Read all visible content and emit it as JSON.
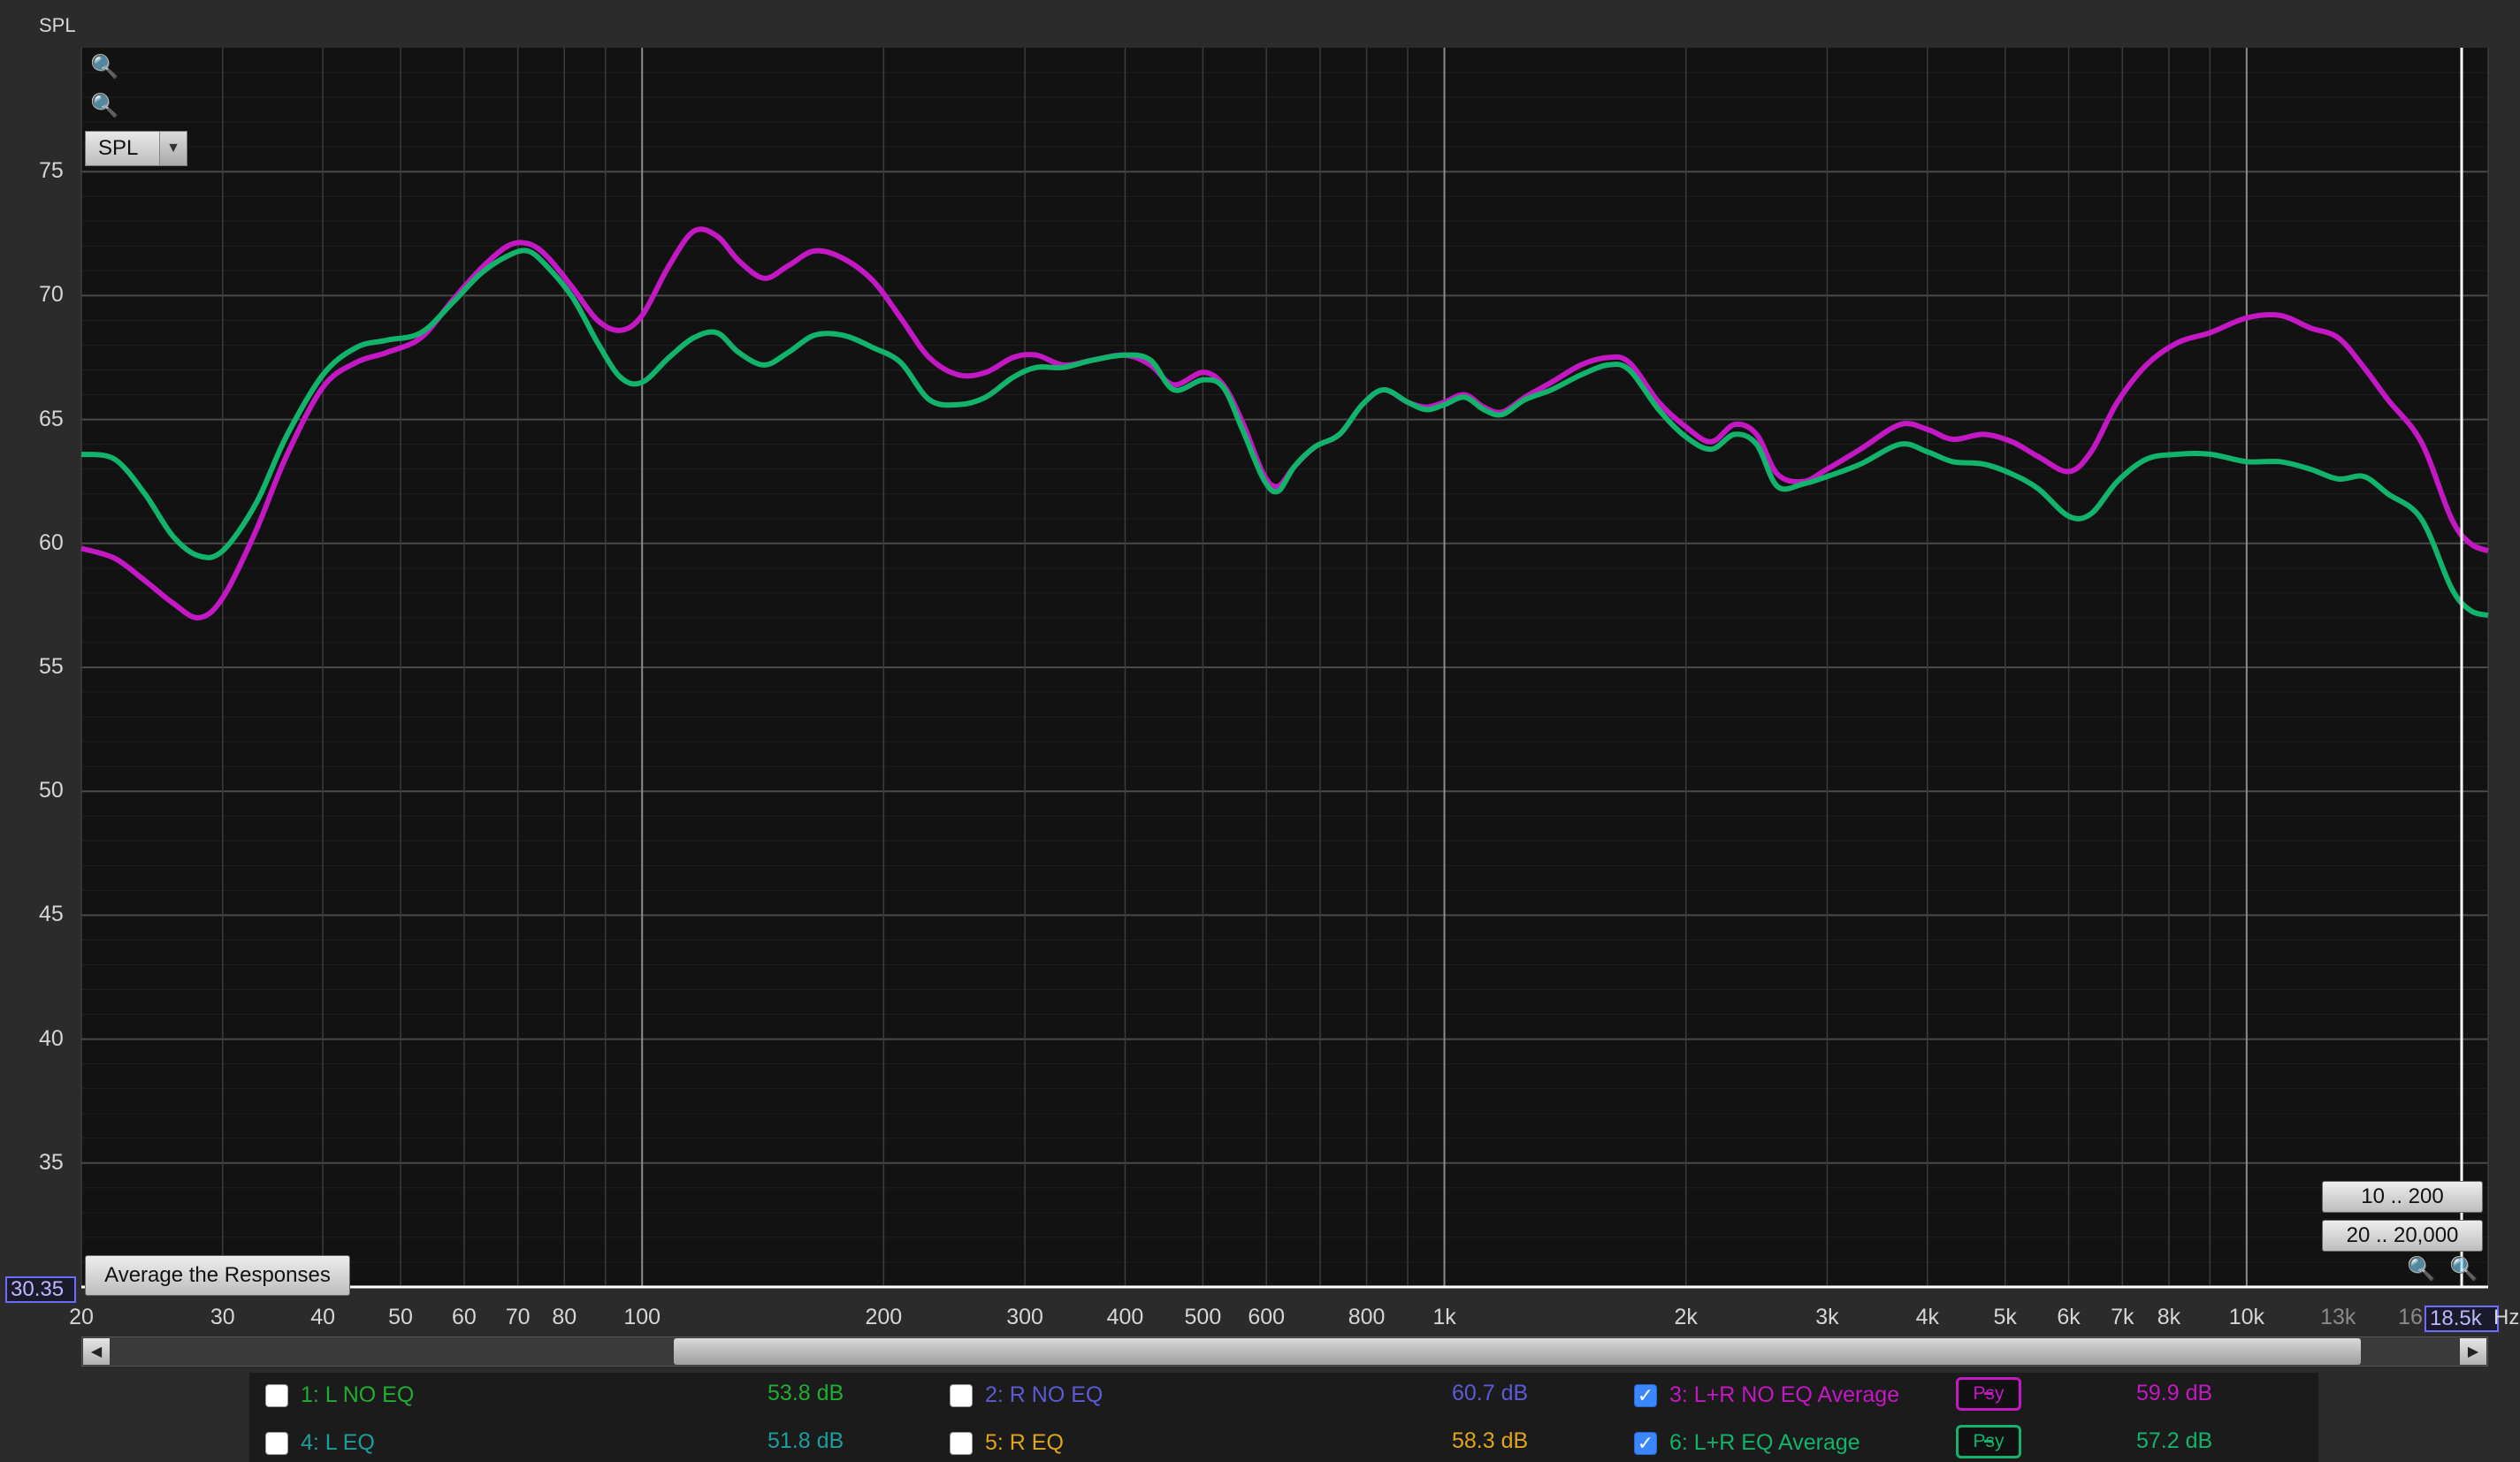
{
  "colors": {
    "background": "#2b2b2b",
    "plot_bg": "#121212",
    "magenta": "#c418c4",
    "green": "#12b36a",
    "l_no_eq": "#1fae2f",
    "r_no_eq": "#5b5bd6",
    "l_eq": "#1d9e9e",
    "r_eq": "#e0a51a"
  },
  "toolbar": {
    "y_title": "SPL",
    "select_value": "SPL",
    "zoom_in_icon": "zoom-in-icon",
    "zoom_out_icon": "zoom-out-icon",
    "average_button": "Average the Responses",
    "range_button_1": "10 .. 200",
    "range_button_2": "20 .. 20,000",
    "cursor_y_value": "30.35",
    "cursor_x_value": "18.5k",
    "x_unit": "Hz"
  },
  "legend": {
    "items": [
      {
        "label": "1: L NO EQ",
        "value": "53.8 dB",
        "checked": false,
        "color": "#1fae2f"
      },
      {
        "label": "2: R NO EQ",
        "value": "60.7 dB",
        "checked": false,
        "color": "#5b5bd6"
      },
      {
        "label": "3: L+R NO EQ Average",
        "value": "59.9 dB",
        "checked": true,
        "color": "#c418c4",
        "smoothing": "Psy"
      },
      {
        "label": "4: L EQ",
        "value": "51.8 dB",
        "checked": false,
        "color": "#1d9e9e"
      },
      {
        "label": "5: R  EQ",
        "value": "58.3 dB",
        "checked": false,
        "color": "#e0a51a"
      },
      {
        "label": "6: L+R EQ Average",
        "value": "57.2 dB",
        "checked": true,
        "color": "#12b36a",
        "smoothing": "Psy"
      }
    ]
  },
  "chart_data": {
    "type": "line",
    "title": "",
    "xlabel": "Hz",
    "ylabel": "SPL",
    "x_scale": "log",
    "xlim": [
      20,
      20000
    ],
    "ylim": [
      30,
      80
    ],
    "grid": true,
    "y_ticks": [
      35,
      40,
      45,
      50,
      55,
      60,
      65,
      70,
      75
    ],
    "x_ticks": [
      {
        "v": 20,
        "label": "20"
      },
      {
        "v": 30,
        "label": "30"
      },
      {
        "v": 40,
        "label": "40"
      },
      {
        "v": 50,
        "label": "50"
      },
      {
        "v": 60,
        "label": "60"
      },
      {
        "v": 70,
        "label": "70"
      },
      {
        "v": 80,
        "label": "80"
      },
      {
        "v": 100,
        "label": "100"
      },
      {
        "v": 200,
        "label": "200"
      },
      {
        "v": 300,
        "label": "300"
      },
      {
        "v": 400,
        "label": "400"
      },
      {
        "v": 500,
        "label": "500"
      },
      {
        "v": 600,
        "label": "600"
      },
      {
        "v": 800,
        "label": "800"
      },
      {
        "v": 1000,
        "label": "1k"
      },
      {
        "v": 2000,
        "label": "2k"
      },
      {
        "v": 3000,
        "label": "3k"
      },
      {
        "v": 4000,
        "label": "4k"
      },
      {
        "v": 5000,
        "label": "5k"
      },
      {
        "v": 6000,
        "label": "6k"
      },
      {
        "v": 7000,
        "label": "7k"
      },
      {
        "v": 8000,
        "label": "8k"
      },
      {
        "v": 10000,
        "label": "10k"
      },
      {
        "v": 13000,
        "label": "13k",
        "dim": true
      },
      {
        "v": 16000,
        "label": "16",
        "dim": true
      }
    ],
    "series": [
      {
        "name": "3: L+R NO EQ Average",
        "color": "#c418c4",
        "points": [
          [
            20,
            59.8
          ],
          [
            22,
            59.4
          ],
          [
            24,
            58.5
          ],
          [
            26,
            57.6
          ],
          [
            28,
            57.0
          ],
          [
            30,
            57.8
          ],
          [
            33,
            60.5
          ],
          [
            36,
            63.5
          ],
          [
            40,
            66.3
          ],
          [
            44,
            67.3
          ],
          [
            48,
            67.7
          ],
          [
            53,
            68.3
          ],
          [
            58,
            69.8
          ],
          [
            63,
            71.1
          ],
          [
            68,
            72.0
          ],
          [
            72,
            72.1
          ],
          [
            76,
            71.6
          ],
          [
            82,
            70.3
          ],
          [
            88,
            69.0
          ],
          [
            94,
            68.6
          ],
          [
            100,
            69.2
          ],
          [
            108,
            71.2
          ],
          [
            116,
            72.6
          ],
          [
            124,
            72.4
          ],
          [
            132,
            71.4
          ],
          [
            142,
            70.7
          ],
          [
            152,
            71.2
          ],
          [
            164,
            71.8
          ],
          [
            178,
            71.5
          ],
          [
            194,
            70.6
          ],
          [
            210,
            69.1
          ],
          [
            228,
            67.5
          ],
          [
            248,
            66.8
          ],
          [
            268,
            66.9
          ],
          [
            290,
            67.5
          ],
          [
            310,
            67.6
          ],
          [
            335,
            67.2
          ],
          [
            365,
            67.4
          ],
          [
            400,
            67.6
          ],
          [
            430,
            67.2
          ],
          [
            460,
            66.4
          ],
          [
            500,
            66.9
          ],
          [
            530,
            66.4
          ],
          [
            560,
            64.9
          ],
          [
            595,
            62.8
          ],
          [
            620,
            62.3
          ],
          [
            650,
            63.1
          ],
          [
            690,
            63.9
          ],
          [
            740,
            64.4
          ],
          [
            790,
            65.6
          ],
          [
            840,
            66.2
          ],
          [
            900,
            65.7
          ],
          [
            950,
            65.5
          ],
          [
            1000,
            65.7
          ],
          [
            1060,
            66.0
          ],
          [
            1120,
            65.5
          ],
          [
            1180,
            65.3
          ],
          [
            1260,
            65.9
          ],
          [
            1360,
            66.5
          ],
          [
            1480,
            67.2
          ],
          [
            1600,
            67.5
          ],
          [
            1700,
            67.3
          ],
          [
            1850,
            65.7
          ],
          [
            2000,
            64.7
          ],
          [
            2150,
            64.1
          ],
          [
            2300,
            64.8
          ],
          [
            2450,
            64.4
          ],
          [
            2600,
            62.8
          ],
          [
            2800,
            62.5
          ],
          [
            3000,
            63.0
          ],
          [
            3300,
            63.8
          ],
          [
            3700,
            64.8
          ],
          [
            4000,
            64.6
          ],
          [
            4300,
            64.2
          ],
          [
            4700,
            64.4
          ],
          [
            5100,
            64.1
          ],
          [
            5500,
            63.5
          ],
          [
            6000,
            62.9
          ],
          [
            6400,
            63.7
          ],
          [
            6900,
            65.7
          ],
          [
            7500,
            67.2
          ],
          [
            8200,
            68.1
          ],
          [
            9000,
            68.5
          ],
          [
            10000,
            69.1
          ],
          [
            11000,
            69.2
          ],
          [
            12000,
            68.7
          ],
          [
            13000,
            68.3
          ],
          [
            14000,
            67.1
          ],
          [
            15000,
            65.8
          ],
          [
            16500,
            64.1
          ],
          [
            18000,
            61.0
          ],
          [
            19000,
            60.0
          ],
          [
            20000,
            59.7
          ]
        ]
      },
      {
        "name": "6: L+R EQ Average",
        "color": "#12b36a",
        "points": [
          [
            20,
            63.6
          ],
          [
            22,
            63.4
          ],
          [
            24,
            62.0
          ],
          [
            26,
            60.3
          ],
          [
            28,
            59.5
          ],
          [
            30,
            59.7
          ],
          [
            33,
            61.6
          ],
          [
            36,
            64.3
          ],
          [
            40,
            66.8
          ],
          [
            44,
            67.9
          ],
          [
            48,
            68.2
          ],
          [
            53,
            68.5
          ],
          [
            58,
            69.7
          ],
          [
            63,
            70.9
          ],
          [
            68,
            71.6
          ],
          [
            72,
            71.8
          ],
          [
            76,
            71.2
          ],
          [
            82,
            69.9
          ],
          [
            88,
            68.1
          ],
          [
            94,
            66.7
          ],
          [
            100,
            66.5
          ],
          [
            108,
            67.5
          ],
          [
            116,
            68.3
          ],
          [
            124,
            68.5
          ],
          [
            132,
            67.7
          ],
          [
            142,
            67.2
          ],
          [
            152,
            67.7
          ],
          [
            164,
            68.4
          ],
          [
            178,
            68.4
          ],
          [
            194,
            67.9
          ],
          [
            210,
            67.3
          ],
          [
            228,
            65.8
          ],
          [
            248,
            65.6
          ],
          [
            268,
            65.9
          ],
          [
            290,
            66.7
          ],
          [
            310,
            67.1
          ],
          [
            335,
            67.1
          ],
          [
            365,
            67.4
          ],
          [
            400,
            67.6
          ],
          [
            430,
            67.4
          ],
          [
            460,
            66.2
          ],
          [
            500,
            66.6
          ],
          [
            530,
            66.3
          ],
          [
            560,
            64.6
          ],
          [
            595,
            62.6
          ],
          [
            620,
            62.1
          ],
          [
            650,
            63.1
          ],
          [
            690,
            63.9
          ],
          [
            740,
            64.4
          ],
          [
            790,
            65.6
          ],
          [
            840,
            66.2
          ],
          [
            900,
            65.7
          ],
          [
            950,
            65.4
          ],
          [
            1000,
            65.6
          ],
          [
            1060,
            65.9
          ],
          [
            1120,
            65.4
          ],
          [
            1180,
            65.2
          ],
          [
            1260,
            65.8
          ],
          [
            1360,
            66.2
          ],
          [
            1480,
            66.8
          ],
          [
            1600,
            67.2
          ],
          [
            1700,
            67.0
          ],
          [
            1850,
            65.4
          ],
          [
            2000,
            64.3
          ],
          [
            2150,
            63.8
          ],
          [
            2300,
            64.4
          ],
          [
            2450,
            64.0
          ],
          [
            2600,
            62.3
          ],
          [
            2800,
            62.4
          ],
          [
            3000,
            62.7
          ],
          [
            3300,
            63.2
          ],
          [
            3700,
            64.0
          ],
          [
            4000,
            63.7
          ],
          [
            4300,
            63.3
          ],
          [
            4700,
            63.2
          ],
          [
            5100,
            62.8
          ],
          [
            5500,
            62.2
          ],
          [
            6000,
            61.1
          ],
          [
            6400,
            61.2
          ],
          [
            6900,
            62.5
          ],
          [
            7500,
            63.4
          ],
          [
            8200,
            63.6
          ],
          [
            9000,
            63.6
          ],
          [
            10000,
            63.3
          ],
          [
            11000,
            63.3
          ],
          [
            12000,
            63.0
          ],
          [
            13000,
            62.6
          ],
          [
            14000,
            62.7
          ],
          [
            15000,
            62.0
          ],
          [
            16500,
            61.0
          ],
          [
            18000,
            58.2
          ],
          [
            19000,
            57.3
          ],
          [
            20000,
            57.1
          ]
        ]
      }
    ]
  }
}
